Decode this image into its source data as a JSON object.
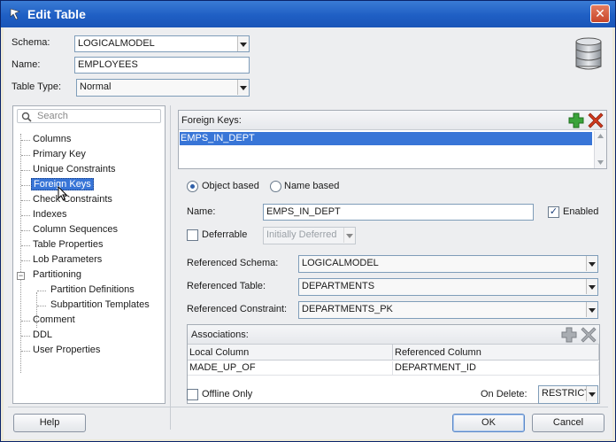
{
  "window": {
    "title": "Edit Table",
    "close_glyph": "✕"
  },
  "header": {
    "schema_label": "Schema:",
    "schema_value": "LOGICALMODEL",
    "name_label": "Name:",
    "name_value": "EMPLOYEES",
    "table_type_label": "Table Type:",
    "table_type_value": "Normal",
    "db_icon": "database-icon"
  },
  "nav": {
    "search_placeholder": "Search",
    "items": [
      {
        "label": "Columns"
      },
      {
        "label": "Primary Key"
      },
      {
        "label": "Unique Constraints"
      },
      {
        "label": "Foreign Keys",
        "selected": true
      },
      {
        "label": "Check Constraints"
      },
      {
        "label": "Indexes"
      },
      {
        "label": "Column Sequences"
      },
      {
        "label": "Table Properties"
      },
      {
        "label": "Lob Parameters"
      },
      {
        "label": "Partitioning",
        "expanded": true
      },
      {
        "label": "Partition Definitions",
        "child": true
      },
      {
        "label": "Subpartition Templates",
        "child": true
      },
      {
        "label": "Comment"
      },
      {
        "label": "DDL"
      },
      {
        "label": "User Properties"
      }
    ]
  },
  "foreign_keys": {
    "header": "Foreign Keys:",
    "rows": [
      "EMPS_IN_DEPT"
    ],
    "add_icon": "add-icon",
    "remove_icon": "remove-icon"
  },
  "detail": {
    "object_based_label": "Object based",
    "name_based_label": "Name based",
    "mode": "object",
    "name_label": "Name:",
    "name_value": "EMPS_IN_DEPT",
    "enabled_label": "Enabled",
    "enabled": true,
    "deferrable_label": "Deferrable",
    "deferrable": false,
    "deferred_value": "Initially Deferred",
    "ref_schema_label": "Referenced Schema:",
    "ref_schema_value": "LOGICALMODEL",
    "ref_table_label": "Referenced Table:",
    "ref_table_value": "DEPARTMENTS",
    "ref_constraint_label": "Referenced Constraint:",
    "ref_constraint_value": "DEPARTMENTS_PK"
  },
  "associations": {
    "header": "Associations:",
    "columns": [
      "Local Column",
      "Referenced Column"
    ],
    "rows": [
      [
        "MADE_UP_OF",
        "DEPARTMENT_ID"
      ]
    ]
  },
  "footer": {
    "offline_only_label": "Offline Only",
    "on_delete_label": "On Delete:",
    "on_delete_value": "RESTRICT",
    "help_label": "Help",
    "ok_label": "OK",
    "cancel_label": "Cancel"
  },
  "colors": {
    "title_bar": "#1f5fc4",
    "selection": "#3875d7",
    "add_green": "#3aa33a",
    "remove_red": "#d23a1e"
  }
}
